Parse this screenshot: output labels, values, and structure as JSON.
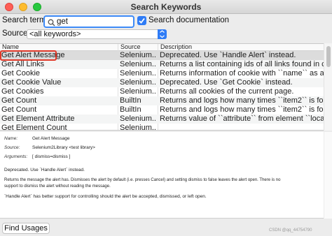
{
  "window": {
    "title": "Search Keywords"
  },
  "search": {
    "label": "Search term:",
    "value": "get",
    "documentation_checkbox": {
      "label": "Search documentation",
      "checked": true
    }
  },
  "source": {
    "label": "Source:",
    "selected": "<all keywords>"
  },
  "table": {
    "columns": [
      "Name",
      "Source",
      "Description"
    ],
    "rows": [
      {
        "name": "Get Alert Message",
        "source": "Selenium...",
        "description": "Deprecated. Use `Handle Alert` instead."
      },
      {
        "name": "Get All Links",
        "source": "Selenium...",
        "description": "Returns a list containing ids of all links found in current..."
      },
      {
        "name": "Get Cookie",
        "source": "Selenium...",
        "description": "Returns information of cookie with ``name`` as an obj..."
      },
      {
        "name": "Get Cookie Value",
        "source": "Selenium...",
        "description": "Deprecated. Use `Get Cookie` instead."
      },
      {
        "name": "Get Cookies",
        "source": "Selenium...",
        "description": "Returns all cookies of the current page."
      },
      {
        "name": "Get Count",
        "source": "BuiltIn",
        "description": "Returns and logs how many times ``item2`` is found f..."
      },
      {
        "name": "Get Count",
        "source": "BuiltIn",
        "description": "Returns and logs how many times ``item2`` is found f..."
      },
      {
        "name": "Get Element Attribute",
        "source": "Selenium...",
        "description": "Returns value of ``attribute`` from element ``locator``..."
      }
    ],
    "partial_row": {
      "name": "Get Element Count",
      "source": "Selenium...",
      "description": ""
    }
  },
  "details": {
    "name_label": "Name:",
    "name_value": "Get Alert Message",
    "source_label": "Source:",
    "source_value": "Selenium2Library <test library>",
    "arguments_label": "Arguments:",
    "arguments_value": "[ dismiss=dismiss ]",
    "doc_line1": "Deprecated. Use `Handle Alert` instead.",
    "doc_line2": "Returns the message the alert has. Dismisses the alert by default (i.e. presses Cancel) and setting dismiss to false leaves the alert open. There is no",
    "doc_line3": "support to dismiss the alert without reading the message.",
    "doc_line4": "`Handle Alert` has better support for controlling should the alert be accepted, dismissed, or left open."
  },
  "footer": {
    "find_usages_label": "Find Usages",
    "watermark": "CSDN @qq_44754790"
  },
  "colors": {
    "accent": "#2f7cf6",
    "highlight_box": "#e03a2a",
    "selected_row": "#dcdcdc"
  }
}
